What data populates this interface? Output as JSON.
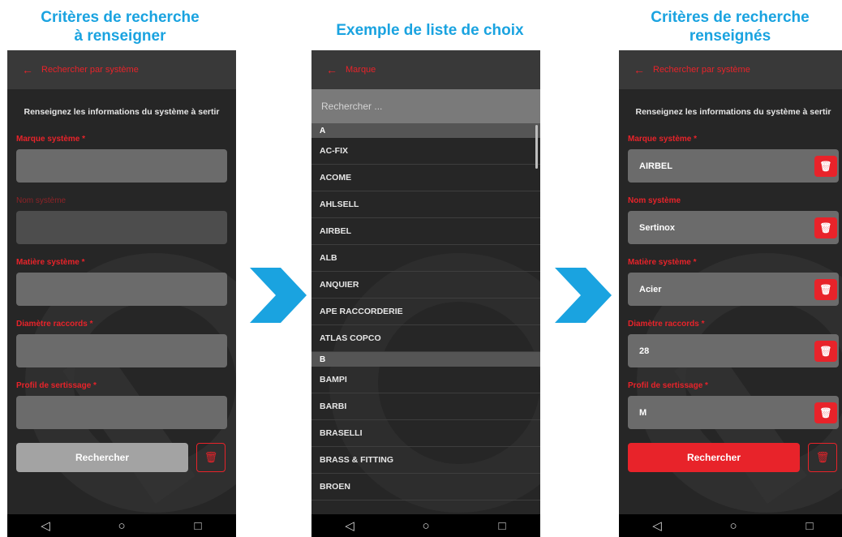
{
  "captions": {
    "left": "Critères de recherche\nà renseigner",
    "middle": "Exemple de liste de choix",
    "right": "Critères de recherche\nrenseignés"
  },
  "left_screen": {
    "appbar_title": "Rechercher par système",
    "intro": "Renseignez les informations du système à sertir",
    "fields": [
      {
        "label": "Marque système *",
        "value": ""
      },
      {
        "label": "Nom système",
        "value": ""
      },
      {
        "label": "Matière système *",
        "value": ""
      },
      {
        "label": "Diamètre raccords *",
        "value": ""
      },
      {
        "label": "Profil de sertissage *",
        "value": ""
      }
    ],
    "search_label": "Rechercher"
  },
  "middle_screen": {
    "appbar_title": "Marque",
    "search_placeholder": "Rechercher ...",
    "sections": [
      {
        "letter": "A",
        "items": [
          "AC-FIX",
          "ACOME",
          "AHLSELL",
          "AIRBEL",
          "ALB",
          "ANQUIER",
          "APE RACCORDERIE",
          "ATLAS COPCO"
        ]
      },
      {
        "letter": "B",
        "items": [
          "BAMPI",
          "BARBI",
          "BRASELLI",
          "BRASS & FITTING",
          "BROEN"
        ]
      }
    ]
  },
  "right_screen": {
    "appbar_title": "Rechercher par système",
    "intro": "Renseignez les informations du système à sertir",
    "fields": [
      {
        "label": "Marque système *",
        "value": "AIRBEL"
      },
      {
        "label": "Nom système",
        "value": "Sertinox"
      },
      {
        "label": "Matière système *",
        "value": "Acier"
      },
      {
        "label": "Diamètre raccords *",
        "value": "28"
      },
      {
        "label": "Profil de sertissage *",
        "value": "M"
      }
    ],
    "search_label": "Rechercher"
  },
  "icons": {
    "back": "arrow-left-icon",
    "trash": "trash-icon",
    "nav_back": "triangle-back-icon",
    "nav_home": "circle-home-icon",
    "nav_recent": "square-recent-icon",
    "flow_arrow": "chevron-right-icon"
  },
  "colors": {
    "accent": "#e8232a",
    "caption": "#1aa3e0",
    "arrow": "#1aa3e0"
  }
}
